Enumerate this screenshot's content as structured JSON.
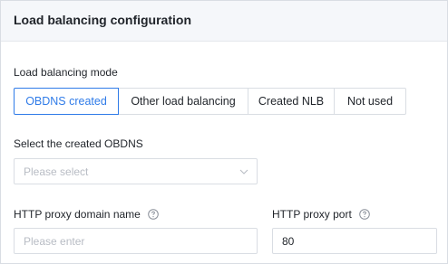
{
  "panel": {
    "title": "Load balancing configuration"
  },
  "mode": {
    "label": "Load balancing mode",
    "options": [
      "OBDNS created",
      "Other load balancing",
      "Created NLB",
      "Not used"
    ],
    "selected": "OBDNS created"
  },
  "obdns": {
    "label": "Select the created OBDNS",
    "placeholder": "Please select",
    "icon": "chevron-down-icon"
  },
  "proxy_domain": {
    "label": "HTTP proxy domain name",
    "placeholder": "Please enter",
    "icon": "help-icon"
  },
  "proxy_port": {
    "label": "HTTP proxy port",
    "value": "80",
    "icon": "help-icon"
  },
  "colors": {
    "accent": "#2f7be8",
    "border": "#d9dde3",
    "header_bg": "#f5f7fa"
  }
}
